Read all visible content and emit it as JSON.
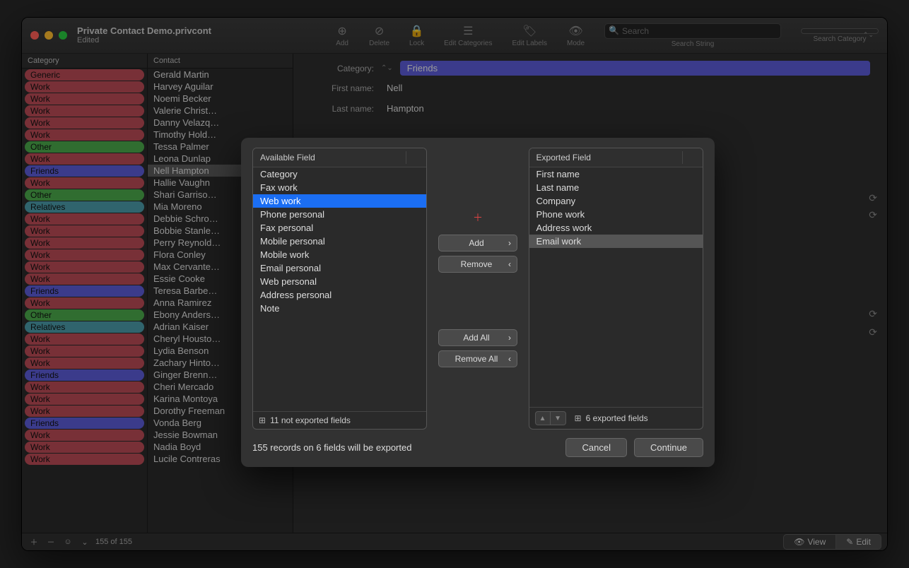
{
  "window": {
    "title": "Private Contact Demo.privcont",
    "subtitle": "Edited"
  },
  "toolbar": {
    "add": "Add",
    "delete": "Delete",
    "lock": "Lock",
    "edit_categories": "Edit Categories",
    "edit_labels": "Edit Labels",
    "mode": "Mode",
    "search_placeholder": "Search",
    "search_label": "Search String",
    "searchcat_label": "Search Category",
    "searchcat_value": ""
  },
  "columns": {
    "category": "Category",
    "contact": "Contact"
  },
  "rows": [
    {
      "cat": "Generic",
      "name": "Gerald Martin"
    },
    {
      "cat": "Work",
      "name": "Harvey Aguilar"
    },
    {
      "cat": "Work",
      "name": "Noemi Becker"
    },
    {
      "cat": "Work",
      "name": "Valerie Christ…"
    },
    {
      "cat": "Work",
      "name": "Danny Velazq…"
    },
    {
      "cat": "Work",
      "name": "Timothy Hold…"
    },
    {
      "cat": "Other",
      "name": "Tessa Palmer"
    },
    {
      "cat": "Work",
      "name": "Leona Dunlap"
    },
    {
      "cat": "Friends",
      "name": "Nell Hampton",
      "sel": true
    },
    {
      "cat": "Work",
      "name": "Hallie Vaughn"
    },
    {
      "cat": "Other",
      "name": "Shari Garriso…"
    },
    {
      "cat": "Relatives",
      "name": "Mia Moreno"
    },
    {
      "cat": "Work",
      "name": "Debbie Schro…"
    },
    {
      "cat": "Work",
      "name": "Bobbie Stanle…"
    },
    {
      "cat": "Work",
      "name": "Perry Reynold…"
    },
    {
      "cat": "Work",
      "name": "Flora Conley"
    },
    {
      "cat": "Work",
      "name": "Max Cervante…"
    },
    {
      "cat": "Work",
      "name": "Essie Cooke"
    },
    {
      "cat": "Friends",
      "name": "Teresa Barbe…"
    },
    {
      "cat": "Work",
      "name": "Anna Ramirez"
    },
    {
      "cat": "Other",
      "name": "Ebony Anders…"
    },
    {
      "cat": "Relatives",
      "name": "Adrian Kaiser"
    },
    {
      "cat": "Work",
      "name": "Cheryl Housto…"
    },
    {
      "cat": "Work",
      "name": "Lydia Benson"
    },
    {
      "cat": "Work",
      "name": "Zachary Hinto…"
    },
    {
      "cat": "Friends",
      "name": "Ginger Brenn…"
    },
    {
      "cat": "Work",
      "name": "Cheri Mercado"
    },
    {
      "cat": "Work",
      "name": "Karina Montoya"
    },
    {
      "cat": "Work",
      "name": "Dorothy Freeman"
    },
    {
      "cat": "Friends",
      "name": "Vonda Berg"
    },
    {
      "cat": "Work",
      "name": "Jessie Bowman"
    },
    {
      "cat": "Work",
      "name": "Nadia Boyd"
    },
    {
      "cat": "Work",
      "name": "Lucile Contreras"
    }
  ],
  "detail": {
    "category_label": "Category:",
    "category_value": "Friends",
    "first_label": "First name:",
    "first_value": "Nell",
    "last_label": "Last name:",
    "last_value": "Hampton"
  },
  "footer": {
    "count": "155 of 155",
    "view": "View",
    "edit": "Edit"
  },
  "modal": {
    "available_header": "Available Field",
    "exported_header": "Exported Field",
    "available": [
      "Category",
      "Fax work",
      "Web work",
      "Phone personal",
      "Fax personal",
      "Mobile personal",
      "Mobile work",
      "Email personal",
      "Web personal",
      "Address personal",
      "Note"
    ],
    "available_selected_index": 2,
    "exported": [
      "First name",
      "Last name",
      "Company",
      "Phone work",
      "Address work",
      "Email work"
    ],
    "exported_selected_index": 5,
    "available_footer": "11 not exported fields",
    "exported_footer": "6 exported fields",
    "add": "Add",
    "remove": "Remove",
    "add_all": "Add All",
    "remove_all": "Remove All",
    "status": "155 records on 6 fields will be exported",
    "cancel": "Cancel",
    "continue": "Continue"
  }
}
